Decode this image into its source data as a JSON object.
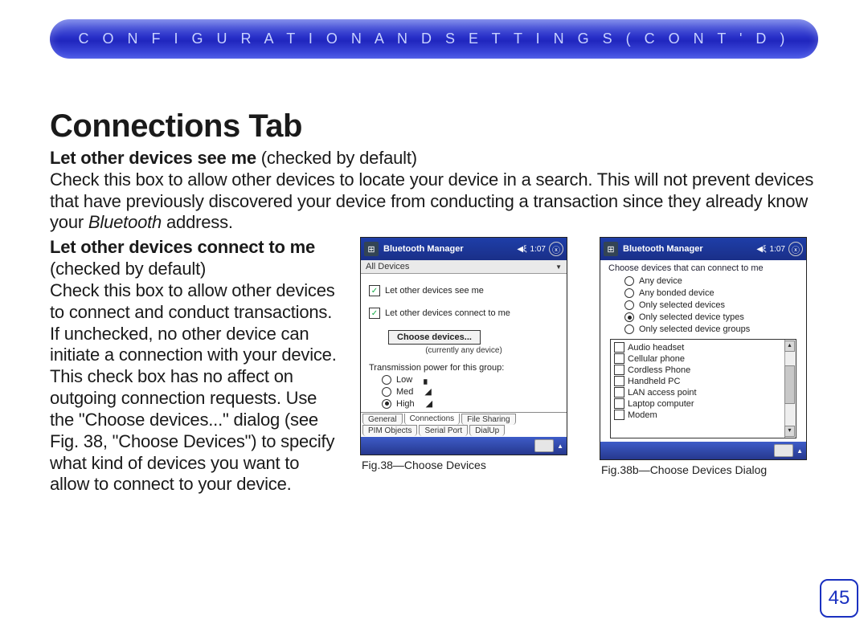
{
  "header": "C O N F I G U R A T I O N   A N D   S E T T I N G S   ( C O N T ' D )",
  "section_title": "Connections Tab",
  "para1": {
    "subhead": "Let other devices see me",
    "default_note": " (checked by default)",
    "body": "Check this box to allow other devices to locate your device in a search. This will not prevent devices that have previously discovered your device from conducting a transaction since they already know your ",
    "italic_word": "Bluetooth",
    "body_tail": " address."
  },
  "para2": {
    "subhead": "Let other devices connect to me",
    "default_note": "(checked by default)",
    "body": "Check this box to allow other devices to connect and conduct transactions. If unchecked, no other device can initiate a connection with your device. This check box has no affect on outgoing connection requests. Use the \"Choose devices...\" dialog (see Fig. 38, \"Choose Devices\") to specify what kind of devices you want to allow to connect to your device."
  },
  "pdaA": {
    "title": "Bluetooth Manager",
    "time": "1:07",
    "subbar": "All Devices",
    "cb1": "Let other devices see me",
    "cb2": "Let other devices connect to me",
    "choose_btn": "Choose devices...",
    "currently": "(currently any device)",
    "power_label": "Transmission power for this group:",
    "power": {
      "low": "Low",
      "med": "Med",
      "high": "High"
    },
    "tabs_row1": [
      "General",
      "Connections",
      "File Sharing"
    ],
    "tabs_row2": [
      "PIM Objects",
      "Serial Port",
      "DialUp"
    ]
  },
  "pdaB": {
    "title": "Bluetooth Manager",
    "time": "1:07",
    "prompt": "Choose devices that can connect to me",
    "radios": [
      "Any device",
      "Any bonded device",
      "Only selected devices",
      "Only selected device types",
      "Only selected device groups"
    ],
    "selected_radio": 3,
    "types": [
      "Audio headset",
      "Cellular phone",
      "Cordless Phone",
      "Handheld PC",
      "LAN access point",
      "Laptop computer",
      "Modem"
    ]
  },
  "captionA": "Fig.38—Choose Devices",
  "captionB": "Fig.38b—Choose Devices Dialog",
  "page_number": "45"
}
